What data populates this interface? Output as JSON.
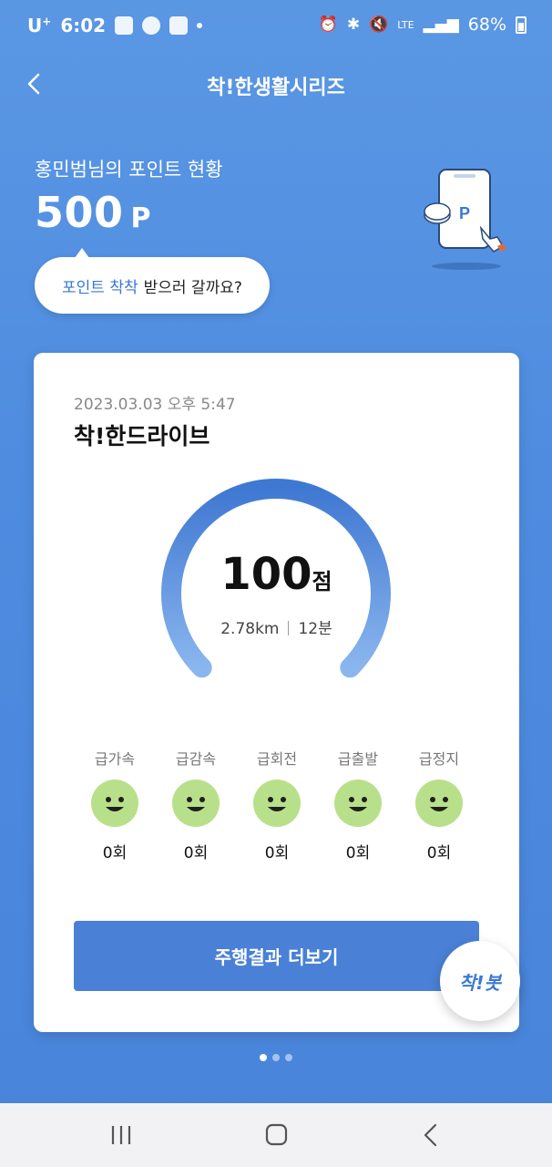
{
  "status_bar": {
    "carrier": "U",
    "carrier_sup": "+",
    "time": "6:02",
    "network": "LTE",
    "battery": "68%"
  },
  "header": {
    "title": "착!한생활시리즈"
  },
  "points": {
    "label": "홍민범님의 포인트 현황",
    "value": "500",
    "unit": "P",
    "illustration_letter": "P"
  },
  "bubble": {
    "highlight": "포인트 착착",
    "rest": "받으러 갈까요?"
  },
  "card": {
    "date": "2023.03.03 오후 5:47",
    "title": "착!한드라이브",
    "score": "100",
    "score_unit": "점",
    "distance": "2.78km",
    "duration": "12분",
    "gauge_level": 1.0,
    "events": [
      {
        "label": "급가속",
        "count": "0회"
      },
      {
        "label": "급감속",
        "count": "0회"
      },
      {
        "label": "급회전",
        "count": "0회"
      },
      {
        "label": "급출발",
        "count": "0회"
      },
      {
        "label": "급정지",
        "count": "0회"
      }
    ],
    "cta_label": "주행결과 더보기"
  },
  "chatbot": {
    "label": "착!봇"
  },
  "pager": {
    "total": 3,
    "active": 1
  },
  "colors": {
    "accent": "#4a80d6",
    "face": "#b8e08a",
    "background": "#5a97e3"
  },
  "icons": {
    "back": "chevron-left-icon",
    "nav_recent": "recent-apps-icon",
    "nav_home": "home-icon",
    "nav_back": "back-icon"
  }
}
